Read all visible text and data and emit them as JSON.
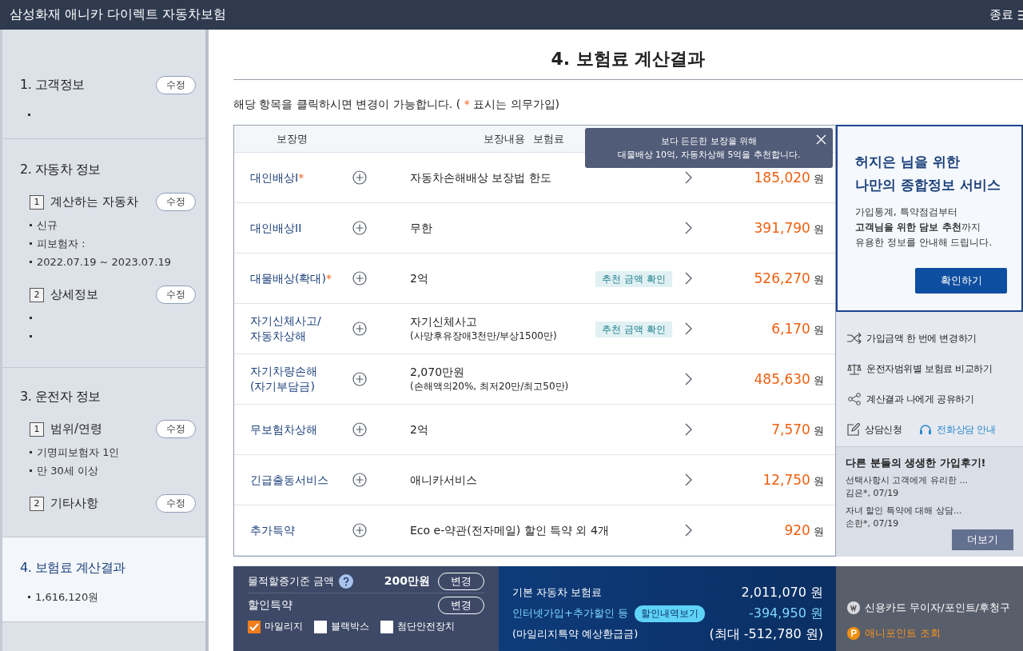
{
  "app_bar": {
    "title": "삼성화재 애니카 다이렉트 자동차보험",
    "exit": "종료"
  },
  "sidebar": {
    "sections": [
      {
        "title": "1. 고객정보",
        "edit": "수정",
        "selected": false,
        "items": [
          {
            "kind": "blank"
          }
        ]
      },
      {
        "title": "2. 자동차 정보",
        "selected": false,
        "subsections": [
          {
            "number": "1",
            "title": "계산하는 자동차",
            "edit": "수정",
            "items": [
              {
                "kind": "text",
                "text": "신규"
              },
              {
                "kind": "text",
                "text": "피보험자 :"
              },
              {
                "kind": "text",
                "text": "2022.07.19 ~ 2023.07.19"
              }
            ]
          },
          {
            "number": "2",
            "title": "상세정보",
            "edit": "수정",
            "items": [
              {
                "kind": "blank"
              },
              {
                "kind": "blank"
              }
            ]
          }
        ]
      },
      {
        "title": "3. 운전자 정보",
        "selected": false,
        "subsections": [
          {
            "number": "1",
            "title": "범위/연령",
            "edit": "수정",
            "items": [
              {
                "kind": "text",
                "text": "기명피보험자 1인"
              },
              {
                "kind": "text",
                "text": "만 30세 이상"
              }
            ]
          },
          {
            "number": "2",
            "title": "기타사항",
            "edit": "수정"
          }
        ]
      },
      {
        "title": "4. 보험료 계산결과",
        "selected": true,
        "items": [
          {
            "kind": "text",
            "text": "1,616,120원"
          }
        ]
      }
    ]
  },
  "main": {
    "title": "4. 보험료 계산결과",
    "notice": {
      "before": "해당 항목을 클릭하시면 변경이 가능합니다. (",
      "mark": "*",
      "after": "표시는 의무가입)"
    }
  },
  "table": {
    "columns": [
      "보장명",
      "보장내용",
      "보험료"
    ],
    "rows": [
      {
        "name": "대인배상I",
        "required": true,
        "detail": "자동차손해배상 보장법 한도",
        "price": "185,020",
        "unit": "원"
      },
      {
        "name": "대인배상II",
        "required": false,
        "detail": "무한",
        "price": "391,790",
        "unit": "원"
      },
      {
        "name": "대물배상(확대)",
        "required": true,
        "detail": "2억",
        "recommend": "추천 금액 확인",
        "price": "526,270",
        "unit": "원"
      },
      {
        "name": "자기신체사고/\n자동차상해",
        "required": false,
        "detail": "자기신체사고",
        "detail_sub": "(사망후유장애3천만/부상1500만)",
        "recommend": "추천 금액 확인",
        "price": "6,170",
        "unit": "원"
      },
      {
        "name": "자기차량손해\n(자기부담금)",
        "required": false,
        "detail": "2,070만원",
        "detail_sub": "(손해액의20%, 최저20만/최고50만)",
        "price": "485,630",
        "unit": "원"
      },
      {
        "name": "무보험차상해",
        "required": false,
        "detail": "2억",
        "price": "7,570",
        "unit": "원"
      },
      {
        "name": "긴급출동서비스",
        "required": false,
        "detail": "애니카서비스",
        "price": "12,750",
        "unit": "원"
      },
      {
        "name": "추가특약",
        "required": false,
        "detail": "Eco e-약관(전자메일) 할인 특약 외 4개",
        "price": "920",
        "unit": "원"
      }
    ],
    "tooltip": {
      "lines": [
        "보다 든든한 보장을 위해",
        "대물배상 10억, 자동차상해 5억을 추천합니다."
      ]
    }
  },
  "promo": {
    "title_lines": [
      "허지은 님을 위한",
      "나만의 종합정보 서비스"
    ],
    "body_lines": [
      "가입통계, 특약점검부터",
      "**고객님을 위한 담보 추천**까지",
      "유용한 정보를 안내해 드립니다."
    ],
    "button": "확인하기"
  },
  "links": [
    {
      "kind": "shuffle",
      "label": "가입금액 한 번에 변경하기"
    },
    {
      "kind": "scale",
      "label": "운전자범위별 보험료 비교하기"
    },
    {
      "kind": "share",
      "label": "계산결과 나에게 공유하기"
    }
  ],
  "contact": [
    {
      "kind": "edit",
      "label": "상담신청"
    },
    {
      "kind": "headset",
      "label": "전화상담 안내"
    }
  ],
  "reviews": {
    "title": "다른 분들의 생생한 가입후기!",
    "items": [
      {
        "text": "선택사항시 고객에게 유리한 ...",
        "author": "김은*, 07/19"
      },
      {
        "text": "자녀 할인 특약에 대해 상담...",
        "author": "손한*, 07/19"
      }
    ],
    "more": "더보기"
  },
  "bottom": {
    "property_label": "물적할증기준 금액",
    "property_value": "200만원",
    "property_change": "변경",
    "discount_label": "할인특약",
    "discount_change": "변경",
    "options": [
      {
        "label": "마일리지",
        "checked": true
      },
      {
        "label": "블랙박스",
        "checked": false
      },
      {
        "label": "첨단안전장치",
        "checked": false
      }
    ],
    "summary": [
      {
        "label": "기본 자동차 보험료",
        "value": "2,011,070 원",
        "highlight": false
      },
      {
        "label": "인터넷가입+추가할인 등",
        "button": "할인내역보기",
        "value": "-394,950 원",
        "highlight": true
      },
      {
        "label": "(마일리지특약 예상환급금)",
        "value": "(최대 -512,780 원)",
        "highlight": false
      }
    ],
    "payments": [
      {
        "kind": "w",
        "label": "신용카드 무이자/포인트/후청구"
      },
      {
        "kind": "p",
        "label": "애니포인트 조회"
      }
    ]
  }
}
